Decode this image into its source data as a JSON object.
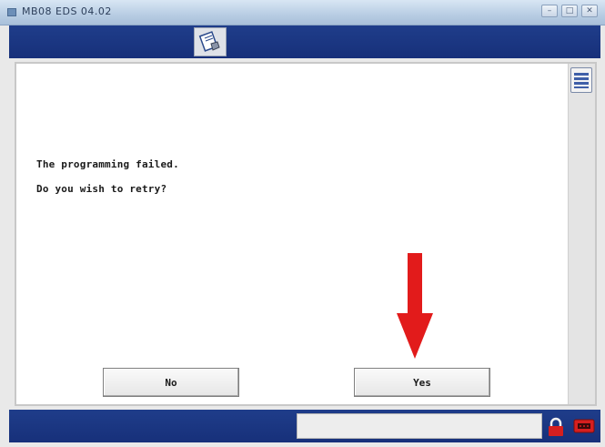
{
  "window": {
    "title": "MB08 EDS 04.02",
    "controls": [
      "–",
      "□",
      "✕"
    ]
  },
  "toolbar": {
    "app_icon": "document-hand-icon"
  },
  "dialog": {
    "message_line1": "The programming failed.",
    "message_line2": "Do you wish to retry?",
    "no_label": "No",
    "yes_label": "Yes"
  },
  "sidebar": {
    "list_icon": "list-icon"
  },
  "statusbar": {
    "lock_icon": "lock-icon",
    "connector_icon": "obd-connector-icon"
  },
  "colors": {
    "bar_blue": "#1f3d8a",
    "annotation_arrow": "#e21b1b",
    "lock_red": "#d61f1f"
  }
}
